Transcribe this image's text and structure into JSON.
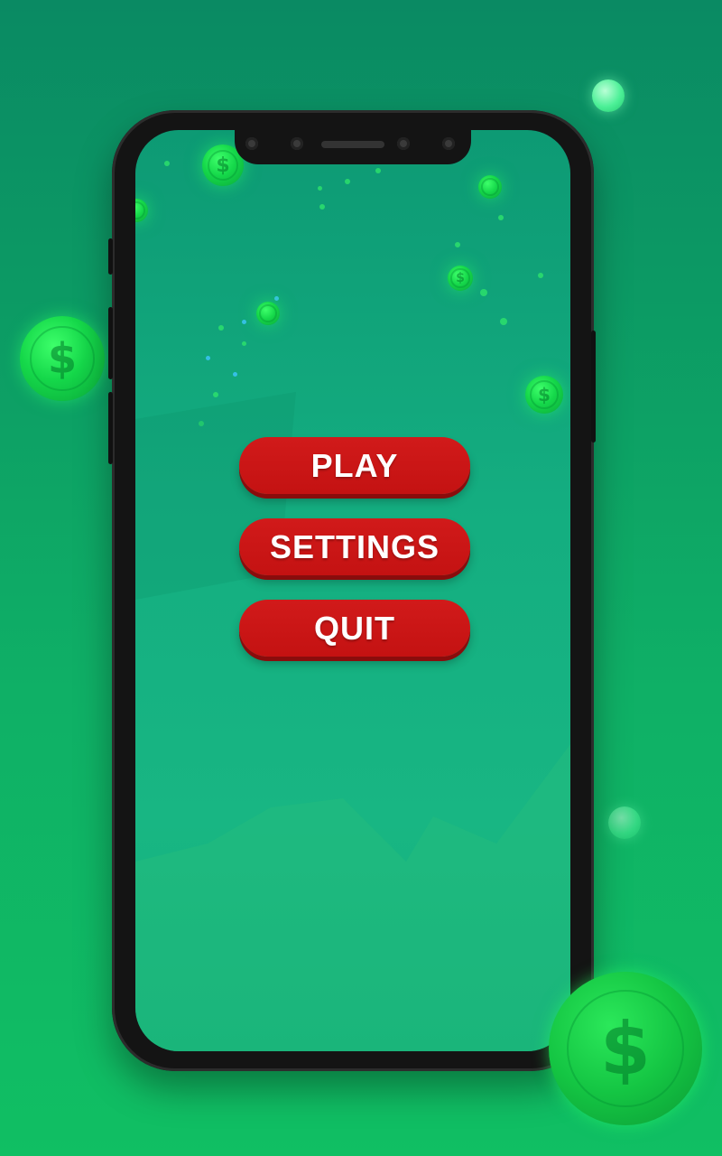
{
  "menu": {
    "play_label": "PLAY",
    "settings_label": "SETTINGS",
    "quit_label": "QUIT"
  },
  "icons": {
    "coin_symbol": "$"
  },
  "colors": {
    "background": "#0fb066",
    "screen": "#14ad80",
    "button": "#c41212",
    "button_text": "#ffffff",
    "coin": "#15d84a"
  }
}
